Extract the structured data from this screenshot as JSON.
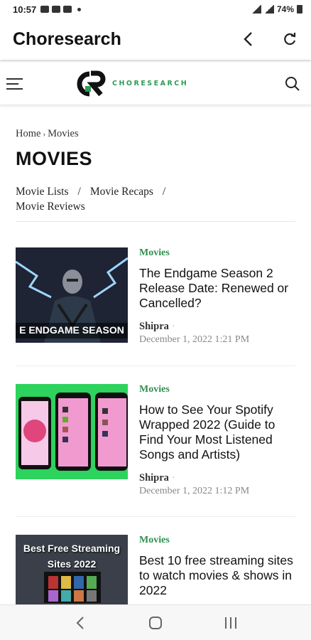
{
  "status": {
    "time": "10:57",
    "battery": "74%"
  },
  "app": {
    "title": "Choresearch"
  },
  "site": {
    "logo_text": "CHORESEARCH"
  },
  "breadcrumb": {
    "home": "Home",
    "sep": "›",
    "current": "Movies"
  },
  "page_title": "MOVIES",
  "subnav": {
    "item1": "Movie Lists",
    "item2": "Movie Recaps",
    "item3": "Movie Reviews",
    "slash": "/"
  },
  "articles": [
    {
      "category": "Movies",
      "title": "The Endgame Season 2 Release Date: Renewed or Cancelled?",
      "author": "Shipra",
      "date": "December 1, 2022 1:21 PM",
      "thumb_caption": "E ENDGAME SEASON"
    },
    {
      "category": "Movies",
      "title": "How to See Your Spotify Wrapped 2022 (Guide to Find Your Most Listened Songs and Artists)",
      "author": "Shipra",
      "date": "December 1, 2022 1:12 PM"
    },
    {
      "category": "Movies",
      "title": "Best 10 free streaming sites to watch movies & shows in 2022",
      "thumb_caption": "Best Free Streaming Sites 2022"
    }
  ],
  "colors": {
    "accent_green": "#2e8f4f",
    "logo_green": "#2e9b57"
  }
}
